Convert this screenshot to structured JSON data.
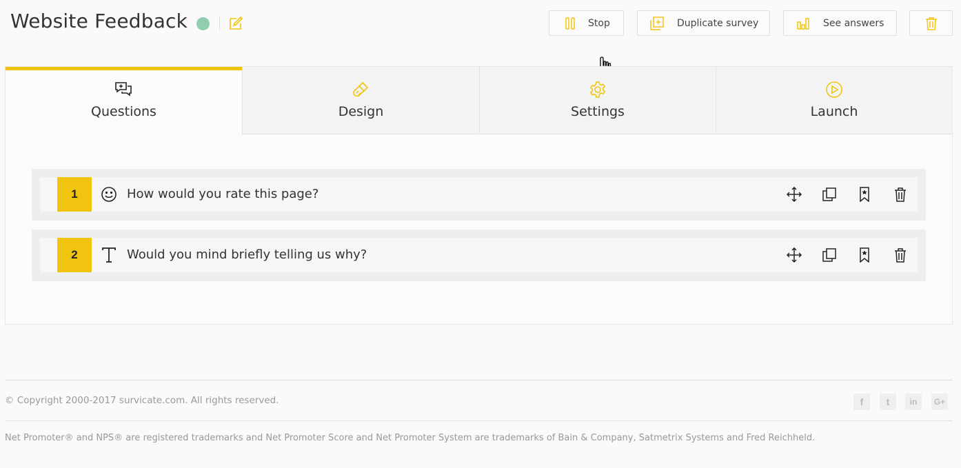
{
  "header": {
    "title": "Website Feedback",
    "status_color": "#8fcfb0",
    "accent": "#f1c40f",
    "buttons": {
      "stop": "Stop",
      "duplicate": "Duplicate survey",
      "answers": "See answers"
    }
  },
  "tabs": [
    {
      "label": "Questions",
      "icon": "add-comment-icon",
      "active": true
    },
    {
      "label": "Design",
      "icon": "paint-brush-icon",
      "active": false
    },
    {
      "label": "Settings",
      "icon": "gear-icon",
      "active": false
    },
    {
      "label": "Launch",
      "icon": "play-circle-icon",
      "active": false
    }
  ],
  "questions": [
    {
      "number": "1",
      "type_icon": "smiley-icon",
      "text": "How would you rate this page?"
    },
    {
      "number": "2",
      "type_icon": "text-type-icon",
      "text": "Would you mind briefly telling us why?"
    }
  ],
  "footer": {
    "copyright": "© Copyright 2000-2017 survicate.com. All rights reserved.",
    "trademark": "Net Promoter® and NPS® are registered trademarks and Net Promoter Score and Net Promoter System are trademarks of Bain & Company, Satmetrix Systems and Fred Reichheld.",
    "social": [
      {
        "name": "facebook-icon",
        "glyph": "f"
      },
      {
        "name": "twitter-icon",
        "glyph": "t"
      },
      {
        "name": "linkedin-icon",
        "glyph": "in"
      },
      {
        "name": "google-plus-icon",
        "glyph": "G+"
      }
    ]
  }
}
